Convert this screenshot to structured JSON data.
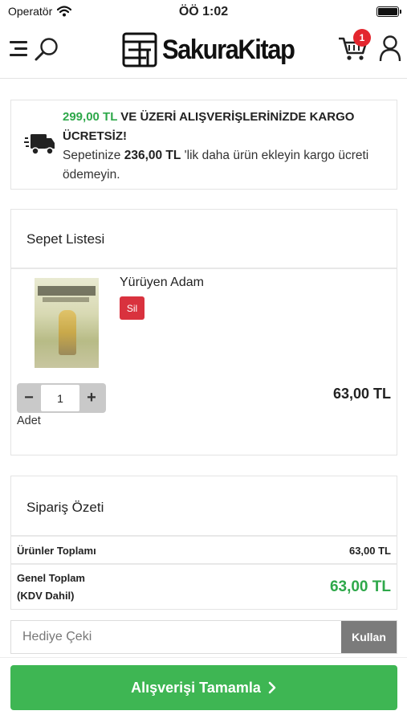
{
  "status_bar": {
    "carrier": "Operatör",
    "time": "ÖÖ 1:02"
  },
  "header": {
    "logo_text": "SakuraKitap",
    "cart_count": "1"
  },
  "shipping": {
    "threshold": "299,00 TL",
    "line1_rest": " VE ÜZERİ ALIŞVERİŞLERİNİZDE KARGO ÜCRETSİZ!",
    "line2_prefix": "Sepetinize ",
    "remaining": "236,00 TL",
    "line2_suffix": " 'lik daha ürün ekleyin kargo ücreti ödemeyin."
  },
  "cart": {
    "title": "Sepet Listesi",
    "items": [
      {
        "name": "Yürüyen Adam",
        "delete_label": "Sil",
        "quantity": "1",
        "quantity_label": "Adet",
        "price": "63,00 TL"
      }
    ]
  },
  "summary": {
    "title": "Sipariş Özeti",
    "products_total_label": "Ürünler Toplamı",
    "products_total": "63,00 TL",
    "grand_total_label_line1": "Genel Toplam",
    "grand_total_label_line2": "(KDV Dahil)",
    "grand_total": "63,00 TL"
  },
  "voucher": {
    "placeholder": "Hediye Çeki",
    "button_label": "Kullan"
  },
  "checkout": {
    "label": "Alışverişi Tamamla"
  },
  "colors": {
    "accent_green": "#3eb653",
    "price_green": "#2ea84a",
    "danger_red": "#d9323e",
    "badge_red": "#e3262e"
  }
}
